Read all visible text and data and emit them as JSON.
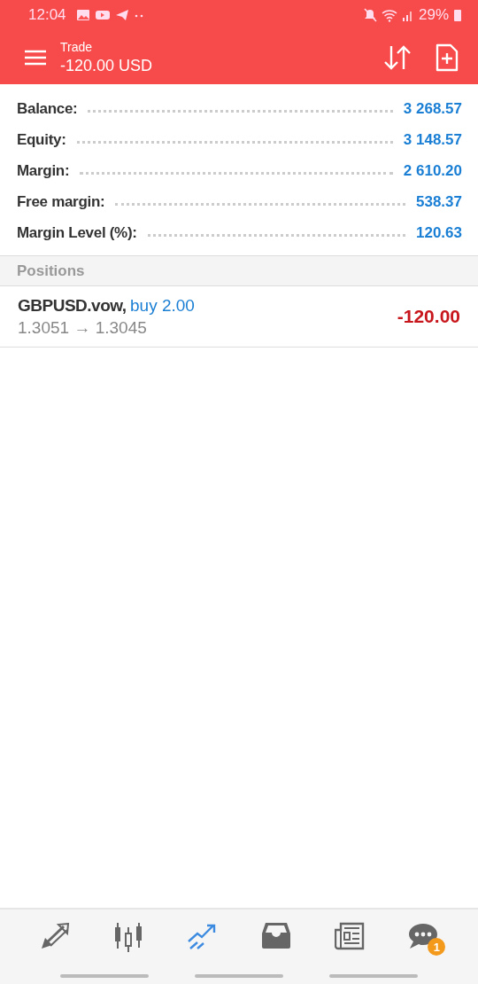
{
  "status_bar": {
    "time": "12:04",
    "battery": "29%"
  },
  "header": {
    "title": "Trade",
    "subtitle": "-120.00 USD"
  },
  "summary": [
    {
      "label": "Balance:",
      "value": "3 268.57"
    },
    {
      "label": "Equity:",
      "value": "3 148.57"
    },
    {
      "label": "Margin:",
      "value": "2 610.20"
    },
    {
      "label": "Free margin:",
      "value": "538.37"
    },
    {
      "label": "Margin Level (%):",
      "value": "120.63"
    }
  ],
  "positions": {
    "title": "Positions",
    "rows": [
      {
        "symbol": "GBPUSD.vow,",
        "side": "buy 2.00",
        "prices": "1.3051 → 1.3045",
        "profit": "-120.00"
      }
    ]
  },
  "nav": [
    {
      "kind": "quotes",
      "selected": false
    },
    {
      "kind": "chart",
      "selected": false
    },
    {
      "kind": "trade",
      "selected": true
    },
    {
      "kind": "history",
      "selected": false
    },
    {
      "kind": "news",
      "selected": false
    },
    {
      "kind": "chat",
      "selected": false,
      "badge": "1"
    }
  ]
}
